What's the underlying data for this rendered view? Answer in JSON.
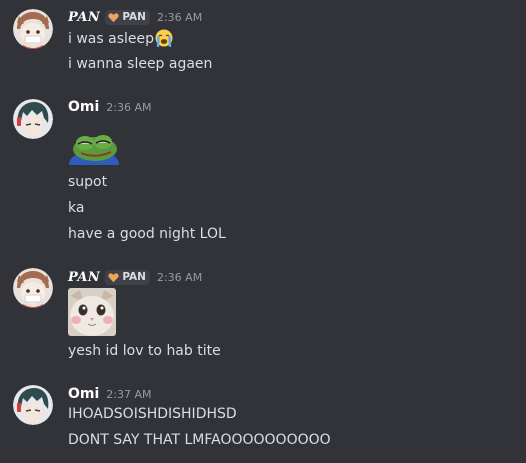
{
  "messages": [
    {
      "username": "PAN",
      "clan_tag": "PAN",
      "timestamp": "2:36 AM",
      "lines": [
        "i was asleep",
        "i wanna sleep agaen"
      ],
      "inline_emoji": "loudly-crying-face"
    },
    {
      "username": "Omi",
      "timestamp": "2:36 AM",
      "sticker": "pepe-frog-sleeping",
      "lines": [
        "supot",
        "ka",
        "have a good night LOL"
      ]
    },
    {
      "username": "PAN",
      "clan_tag": "PAN",
      "timestamp": "2:36 AM",
      "image": "crying-cat-photo",
      "lines": [
        "yesh id lov to hab tite"
      ]
    },
    {
      "username": "Omi",
      "timestamp": "2:37 AM",
      "lines": [
        "IHOADSOISHDISHIDHSD",
        "DONT SAY THAT LMFAOOOOOOOOOO"
      ]
    }
  ],
  "colors": {
    "background": "#313338",
    "text": "#dbdee1",
    "username": "#ffffff",
    "timestamp": "#949ba4",
    "clan_tag_bg": "#3f4147",
    "clan_heart": "#f0a35a"
  }
}
